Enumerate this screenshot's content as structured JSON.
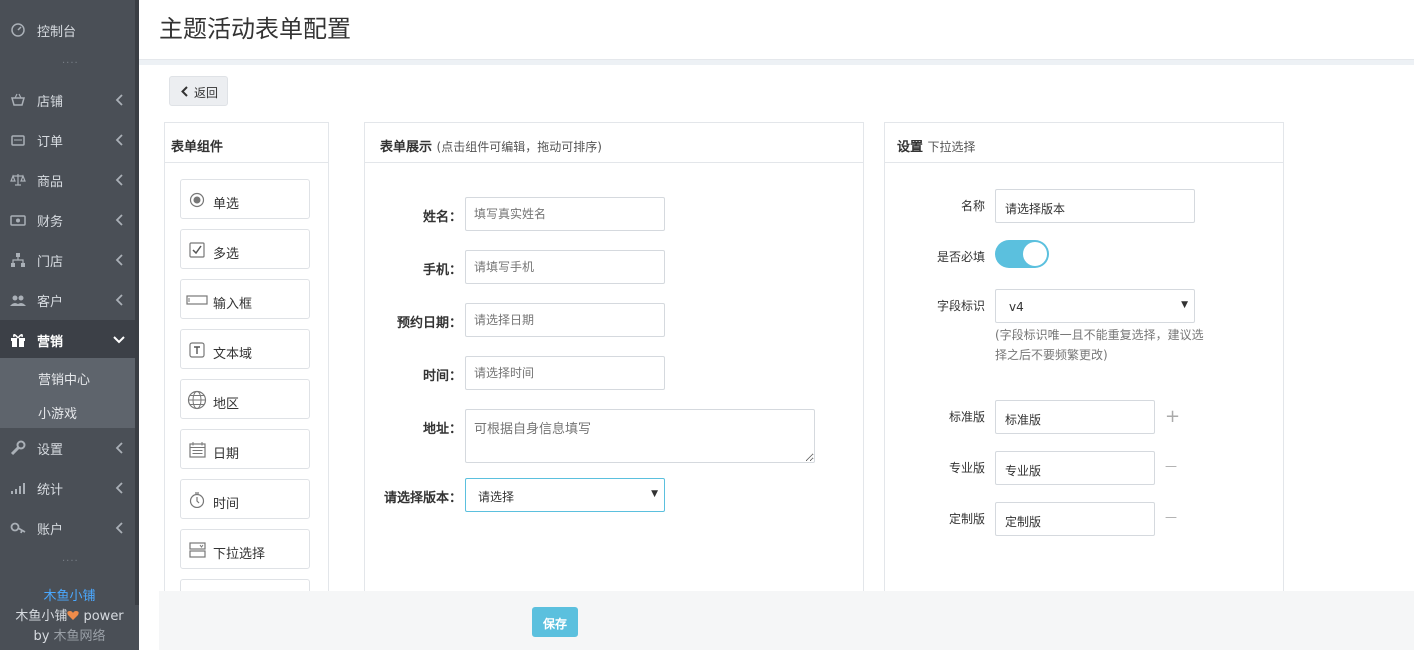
{
  "header": {
    "title": "主题活动表单配置"
  },
  "sidebar": {
    "items": [
      {
        "icon": "dashboard-icon",
        "label": "控制台"
      },
      {
        "icon": "store-icon",
        "label": "店铺"
      },
      {
        "icon": "order-icon",
        "label": "订单"
      },
      {
        "icon": "scale-icon",
        "label": "商品"
      },
      {
        "icon": "finance-icon",
        "label": "财务"
      },
      {
        "icon": "branch-icon",
        "label": "门店"
      },
      {
        "icon": "customers-icon",
        "label": "客户"
      },
      {
        "icon": "gift-icon",
        "label": "营销"
      },
      {
        "icon": "wrench-icon",
        "label": "设置"
      },
      {
        "icon": "stats-icon",
        "label": "统计"
      },
      {
        "icon": "key-icon",
        "label": "账户"
      }
    ],
    "subitems": [
      {
        "label": "营销中心"
      },
      {
        "label": "小游戏"
      }
    ],
    "brand": {
      "name": "木鱼小铺",
      "power_prefix": "木鱼小铺",
      "power_suffix": " power",
      "by": "by ",
      "company": "木鱼网络"
    }
  },
  "toolbar": {
    "back_label": "返回"
  },
  "components_panel": {
    "title": "表单组件",
    "items": [
      {
        "icon": "radio-icon",
        "label": "单选"
      },
      {
        "icon": "checkbox-icon",
        "label": "多选"
      },
      {
        "icon": "input-icon",
        "label": "输入框"
      },
      {
        "icon": "textarea-icon",
        "label": "文本域"
      },
      {
        "icon": "globe-icon",
        "label": "地区"
      },
      {
        "icon": "calendar-icon",
        "label": "日期"
      },
      {
        "icon": "clock-icon",
        "label": "时间"
      },
      {
        "icon": "dropdown-icon",
        "label": "下拉选择"
      }
    ]
  },
  "form_panel": {
    "title": "表单展示",
    "subtitle": "(点击组件可编辑，拖动可排序)",
    "fields": [
      {
        "label": "姓名：",
        "placeholder": "填写真实姓名"
      },
      {
        "label": "手机：",
        "placeholder": "请填写手机"
      },
      {
        "label": "预约日期：",
        "placeholder": "请选择日期"
      },
      {
        "label": "时间：",
        "placeholder": "请选择时间"
      },
      {
        "label": "地址：",
        "placeholder": "可根据自身信息填写"
      },
      {
        "label": "请选择版本：",
        "value": "请选择"
      }
    ]
  },
  "settings_panel": {
    "title": "设置",
    "subtitle": "下拉选择",
    "name_label": "名称",
    "name_value": "请选择版本",
    "required_label": "是否必填",
    "required": true,
    "field_label": "字段标识",
    "field_value": "v4",
    "field_hint": "(字段标识唯一且不能重复选择，建议选择之后不要频繁更改)",
    "options": [
      {
        "label": "标准版",
        "value": "标准版",
        "action": "+"
      },
      {
        "label": "专业版",
        "value": "专业版",
        "action": "—"
      },
      {
        "label": "定制版",
        "value": "定制版",
        "action": "—"
      }
    ]
  },
  "footer": {
    "save_label": "保存"
  },
  "colors": {
    "accent": "#5bc0de",
    "sidebar_bg": "#4a4f56",
    "brand_link": "#4aa8ff",
    "heart": "#f08c4a"
  }
}
